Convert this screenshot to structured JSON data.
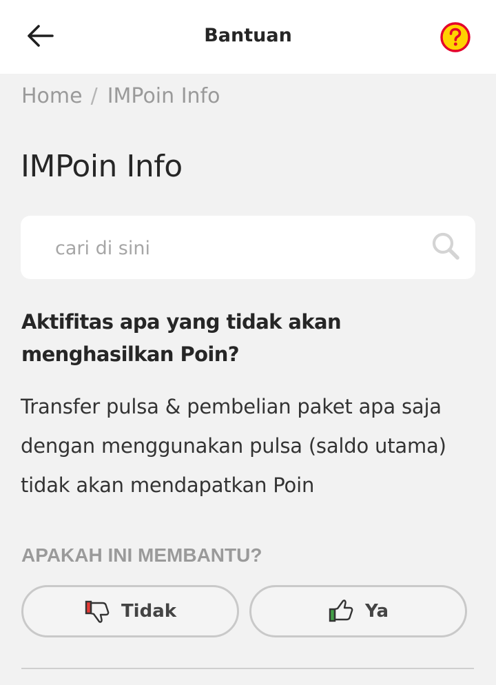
{
  "header": {
    "title": "Bantuan",
    "back_icon": "arrow-left-icon",
    "help_icon": "question-circle-icon"
  },
  "breadcrumb": {
    "home": "Home",
    "separator": "/",
    "current": "IMPoin Info"
  },
  "page": {
    "title": "IMPoin Info"
  },
  "search": {
    "value": "",
    "placeholder": "cari di sini",
    "icon": "search-icon"
  },
  "article": {
    "question": "Aktifitas apa yang tidak akan menghasilkan Poin?",
    "answer": "Transfer pulsa & pembelian paket apa saja dengan menggunakan pulsa (saldo utama) tidak akan mendapatkan Poin"
  },
  "feedback": {
    "prompt": "APAKAH INI MEMBANTU?",
    "no_label": "Tidak",
    "yes_label": "Ya",
    "no_icon": "thumbs-down-icon",
    "yes_icon": "thumbs-up-icon"
  },
  "colors": {
    "brand_red": "#e4002b",
    "brand_yellow": "#ffd200",
    "thumbs_down_accent": "#e53935",
    "thumbs_up_accent": "#43a047",
    "background": "#f2f2f2"
  }
}
